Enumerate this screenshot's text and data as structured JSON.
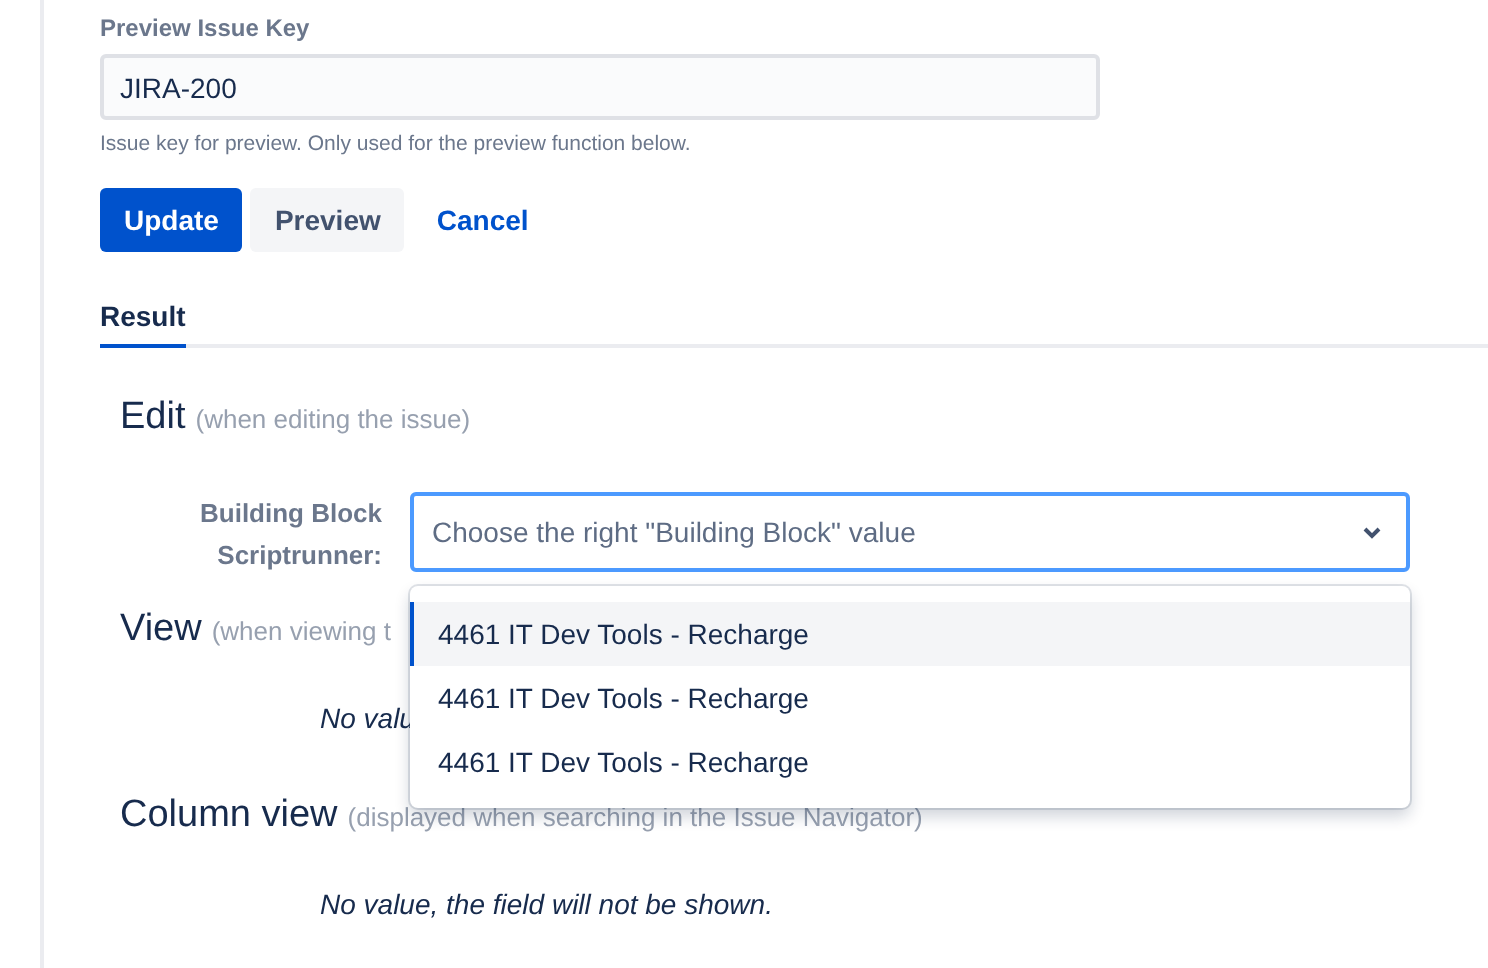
{
  "preview_field": {
    "label": "Preview Issue Key",
    "value": "JIRA-200",
    "help": "Issue key for preview. Only used for the preview function below."
  },
  "buttons": [
    {
      "kind": "primary",
      "label": "Update"
    },
    {
      "kind": "secondary",
      "label": "Preview"
    },
    {
      "kind": "link",
      "label": "Cancel"
    }
  ],
  "tabs": [
    {
      "label": "Result",
      "selected": true
    }
  ],
  "sections": [
    {
      "title": "Edit",
      "note": "(when editing the issue)",
      "kind": "field",
      "field_label": "Building Block Scriptrunner:",
      "placeholder": "Choose the right \"Building Block\" value",
      "expanded": true,
      "options": [
        {
          "label": "4461 IT Dev Tools - Recharge",
          "selected": true
        },
        {
          "label": "4461 IT Dev Tools - Recharge",
          "selected": false
        },
        {
          "label": "4461 IT Dev Tools - Recharge",
          "selected": false
        }
      ]
    },
    {
      "title": "View",
      "note": "(when viewing t",
      "kind": "message",
      "message": "No valu"
    },
    {
      "title": "Column view",
      "note": "(displayed when searching in the Issue Navigator)",
      "kind": "message",
      "message": "No value, the field will not be shown."
    }
  ]
}
